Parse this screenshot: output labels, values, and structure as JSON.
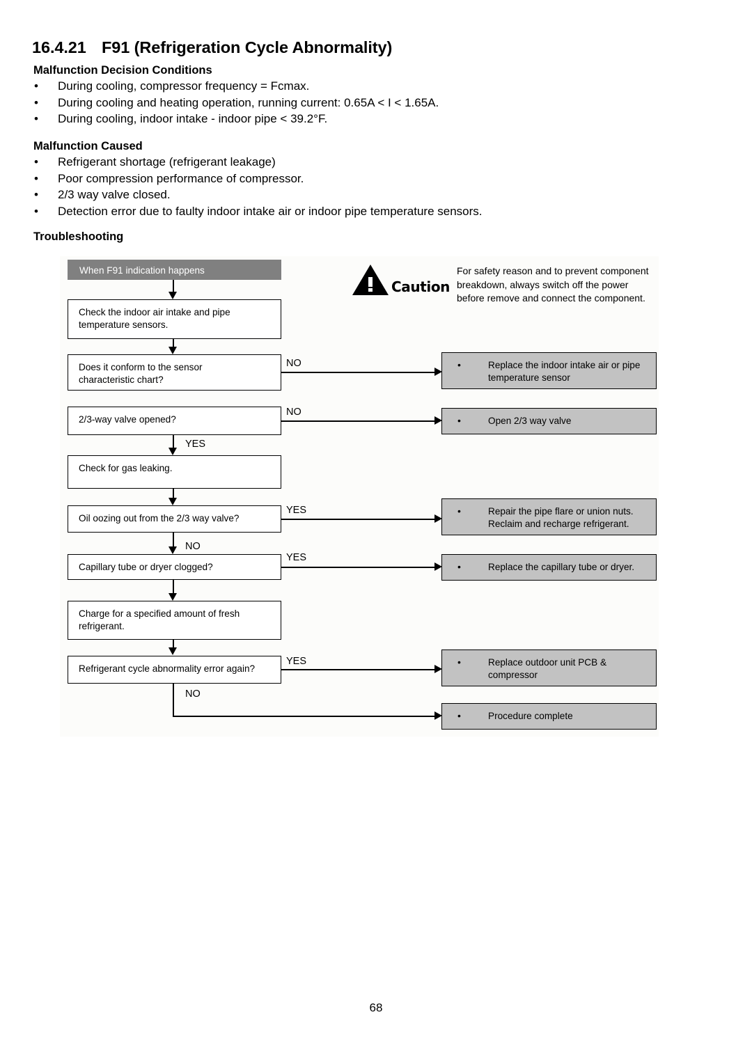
{
  "document": {
    "section_number": "16.4.21",
    "section_title": "F91 (Refrigeration Cycle Abnormality)",
    "page_number": "68"
  },
  "malfunction_decision_conditions": {
    "heading": "Malfunction Decision Conditions",
    "items": [
      "During cooling, compressor frequency = Fcmax.",
      "During cooling and heating operation, running current: 0.65A < I < 1.65A.",
      "During cooling, indoor intake - indoor pipe < 39.2°F."
    ]
  },
  "malfunction_caused": {
    "heading": "Malfunction Caused",
    "items": [
      "Refrigerant shortage (refrigerant leakage)",
      "Poor compression performance of compressor.",
      "2/3 way valve closed.",
      "Detection error due to faulty indoor intake air or indoor pipe temperature sensors."
    ]
  },
  "troubleshooting": {
    "heading": "Troubleshooting",
    "caution": {
      "label": "Caution",
      "line1": "For safety reason and to prevent component",
      "line2": "breakdown, always switch off the power",
      "line3": "before remove and connect the component."
    },
    "nodes": {
      "start": "When F91 indication happens",
      "check_sensors_l1": "Check the indoor air intake and pipe",
      "check_sensors_l2": "temperature sensors.",
      "conform_chart_l1": "Does it conform to the sensor",
      "conform_chart_l2": "characteristic chart?",
      "valve_opened": "2/3-way valve opened?",
      "check_gas_leak": "Check for gas leaking.",
      "oil_oozing": "Oil oozing out from the 2/3 way valve?",
      "capillary_clogged": "Capillary tube or dryer clogged?",
      "charge_refrigerant_l1": "Charge for a specified amount of fresh",
      "charge_refrigerant_l2": "refrigerant.",
      "error_again": "Refrigerant cycle abnormality error again?"
    },
    "actions": {
      "replace_sensor_l1": "Replace the indoor intake air or pipe",
      "replace_sensor_l2": "temperature sensor",
      "open_valve": "Open 2/3 way valve",
      "repair_flare_l1": "Repair the pipe flare or union nuts.",
      "repair_flare_l2": "Reclaim and recharge refrigerant.",
      "replace_capillary": "Replace the capillary tube or dryer.",
      "replace_pcb_l1": "Replace outdoor unit PCB &",
      "replace_pcb_l2": "compressor",
      "procedure_complete": "Procedure complete"
    },
    "edge_labels": {
      "no_1": "NO",
      "no_2": "NO",
      "yes_1": "YES",
      "yes_2": "YES",
      "no_3": "NO",
      "yes_3": "YES",
      "yes_4": "YES",
      "no_4": "NO"
    },
    "bullet_glyph": "•",
    "colors": {
      "start_fill": "#808080",
      "action_fill": "#c2c2c2",
      "border": "#000000",
      "canvas": "#fcfcfa"
    }
  }
}
